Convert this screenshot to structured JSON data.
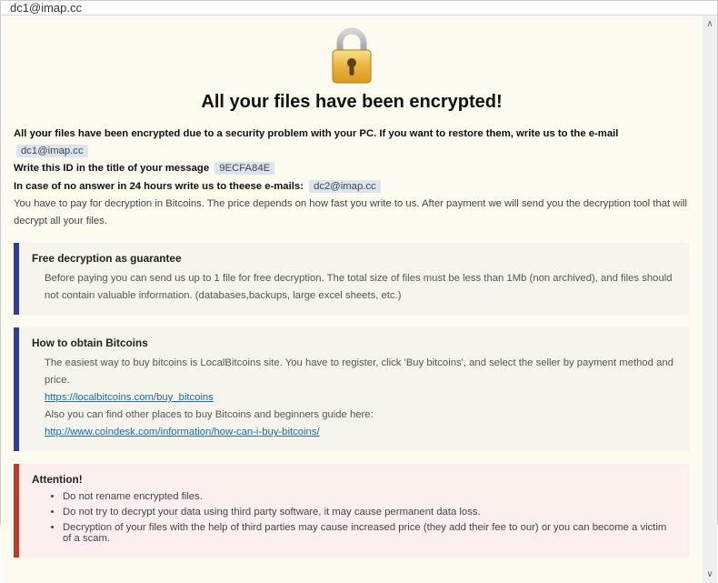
{
  "titlebar": {
    "text": "dc1@imap.cc"
  },
  "heading": "All your files have been encrypted!",
  "intro": {
    "line1_prefix": "All your files have been encrypted due to a security problem with your PC. If you want to restore them, write us to the e-mail",
    "email1": "dc1@imap.cc",
    "line2_prefix": "Write this ID in the title of your message",
    "id": "9ECFA84E",
    "line3_prefix": "In case of no answer in 24 hours write us to theese e-mails:",
    "email2": "dc2@imap.cc",
    "payment": "You have to pay for decryption in Bitcoins. The price depends on how fast you write to us. After payment we will send you the decryption tool that will decrypt all your files."
  },
  "guarantee": {
    "title": "Free decryption as guarantee",
    "body": "Before paying you can send us up to 1 file for free decryption. The total size of files must be less than 1Mb (non archived), and files should not contain valuable information. (databases,backups, large excel sheets, etc.)"
  },
  "obtain": {
    "title": "How to obtain Bitcoins",
    "line1": "The easiest way to buy bitcoins is LocalBitcoins site. You have to register, click 'Buy bitcoins', and select the seller by payment method and price.",
    "link1": "https://localbitcoins.com/buy_bitcoins",
    "line2": "Also you can find other places to buy Bitcoins and beginners guide here:",
    "link2": "http://www.coindesk.com/information/how-can-i-buy-bitcoins/"
  },
  "attention": {
    "title": "Attention!",
    "items": [
      "Do not rename encrypted files.",
      "Do not try to decrypt your data using third party software, it may cause permanent data loss.",
      "Decryption of your files with the help of third parties may cause increased price (they add their fee to our) or you can become a victim of a scam."
    ]
  }
}
